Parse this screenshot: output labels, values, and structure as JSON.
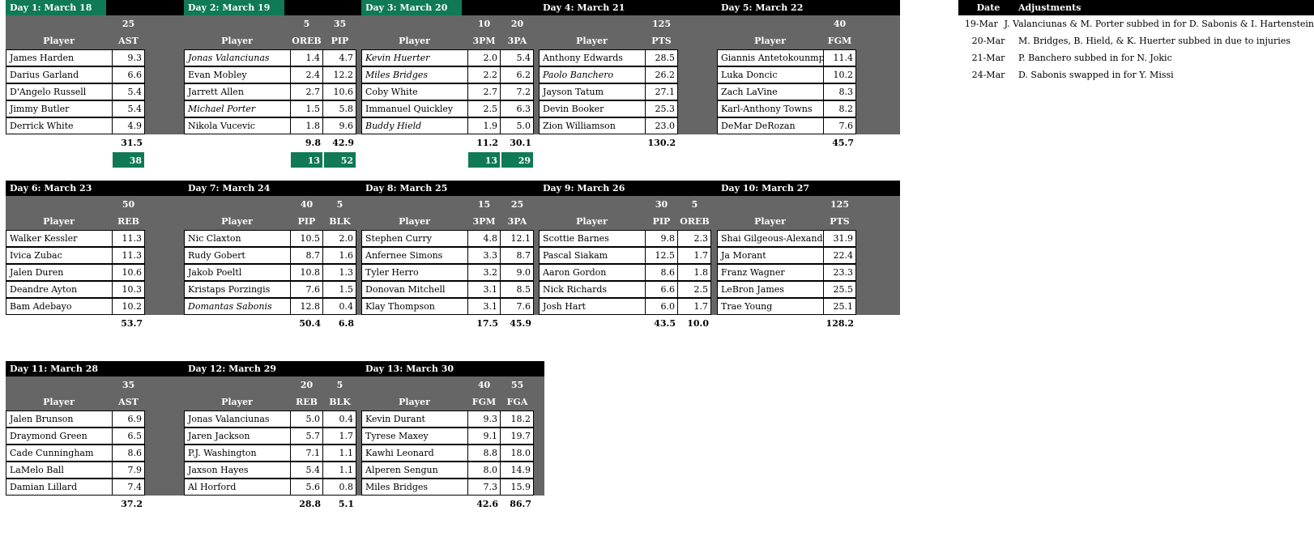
{
  "days": [
    {
      "title": "Day 1: March 18",
      "highlight": true,
      "targets": [
        "25"
      ],
      "stats": [
        "AST"
      ],
      "player_header": "Player",
      "rows": [
        {
          "name": "James Harden",
          "vals": [
            "9.3"
          ]
        },
        {
          "name": "Darius Garland",
          "vals": [
            "6.6"
          ]
        },
        {
          "name": "D'Angelo Russell",
          "vals": [
            "5.4"
          ]
        },
        {
          "name": "Jimmy Butler",
          "vals": [
            "5.4"
          ]
        },
        {
          "name": "Derrick White",
          "vals": [
            "4.9"
          ]
        }
      ],
      "totals": [
        "31.5"
      ],
      "results": [
        "38"
      ]
    },
    {
      "title": "Day 2: March 19",
      "highlight": true,
      "targets": [
        "5",
        "35"
      ],
      "stats": [
        "OREB",
        "PIP"
      ],
      "player_header": "Player",
      "rows": [
        {
          "name": "Jonas Valanciunas",
          "italic": true,
          "vals": [
            "1.4",
            "4.7"
          ]
        },
        {
          "name": "Evan Mobley",
          "vals": [
            "2.4",
            "12.2"
          ]
        },
        {
          "name": "Jarrett Allen",
          "vals": [
            "2.7",
            "10.6"
          ]
        },
        {
          "name": "Michael Porter",
          "italic": true,
          "vals": [
            "1.5",
            "5.8"
          ]
        },
        {
          "name": "Nikola Vucevic",
          "vals": [
            "1.8",
            "9.6"
          ]
        }
      ],
      "totals": [
        "9.8",
        "42.9"
      ],
      "results": [
        "13",
        "52"
      ]
    },
    {
      "title": "Day 3: March 20",
      "highlight": true,
      "targets": [
        "10",
        "20"
      ],
      "stats": [
        "3PM",
        "3PA"
      ],
      "player_header": "Player",
      "rows": [
        {
          "name": "Kevin Huerter",
          "italic": true,
          "vals": [
            "2.0",
            "5.4"
          ]
        },
        {
          "name": "Miles Bridges",
          "italic": true,
          "vals": [
            "2.2",
            "6.2"
          ]
        },
        {
          "name": "Coby White",
          "vals": [
            "2.7",
            "7.2"
          ]
        },
        {
          "name": "Immanuel Quickley",
          "vals": [
            "2.5",
            "6.3"
          ]
        },
        {
          "name": "Buddy Hield",
          "italic": true,
          "vals": [
            "1.9",
            "5.0"
          ]
        }
      ],
      "totals": [
        "11.2",
        "30.1"
      ],
      "results": [
        "13",
        "29"
      ]
    },
    {
      "title": "Day 4: March 21",
      "highlight": false,
      "targets": [
        "125"
      ],
      "stats": [
        "PTS"
      ],
      "player_header": "Player",
      "rows": [
        {
          "name": "Anthony Edwards",
          "vals": [
            "28.5"
          ]
        },
        {
          "name": "Paolo Banchero",
          "italic": true,
          "vals": [
            "26.2"
          ]
        },
        {
          "name": "Jayson Tatum",
          "vals": [
            "27.1"
          ]
        },
        {
          "name": "Devin Booker",
          "vals": [
            "25.3"
          ]
        },
        {
          "name": "Zion Williamson",
          "vals": [
            "23.0"
          ]
        }
      ],
      "totals": [
        "130.2"
      ],
      "results": []
    },
    {
      "title": "Day 5: March 22",
      "highlight": false,
      "targets": [
        "40"
      ],
      "stats": [
        "FGM"
      ],
      "player_header": "Player",
      "rows": [
        {
          "name": "Giannis Antetokounmpo",
          "vals": [
            "11.4"
          ]
        },
        {
          "name": "Luka Doncic",
          "vals": [
            "10.2"
          ]
        },
        {
          "name": "Zach LaVine",
          "vals": [
            "8.3"
          ]
        },
        {
          "name": "Karl-Anthony Towns",
          "vals": [
            "8.2"
          ]
        },
        {
          "name": "DeMar DeRozan",
          "vals": [
            "7.6"
          ]
        }
      ],
      "totals": [
        "45.7"
      ],
      "results": []
    },
    {
      "title": "Day 6: March 23",
      "highlight": false,
      "targets": [
        "50"
      ],
      "stats": [
        "REB"
      ],
      "player_header": "Player",
      "rows": [
        {
          "name": "Walker Kessler",
          "vals": [
            "11.3"
          ]
        },
        {
          "name": "Ivica Zubac",
          "vals": [
            "11.3"
          ]
        },
        {
          "name": "Jalen Duren",
          "vals": [
            "10.6"
          ]
        },
        {
          "name": "Deandre Ayton",
          "vals": [
            "10.3"
          ]
        },
        {
          "name": "Bam Adebayo",
          "vals": [
            "10.2"
          ]
        }
      ],
      "totals": [
        "53.7"
      ],
      "results": []
    },
    {
      "title": "Day 7: March 24",
      "highlight": false,
      "targets": [
        "40",
        "5"
      ],
      "stats": [
        "PIP",
        "BLK"
      ],
      "player_header": "Player",
      "rows": [
        {
          "name": "Nic Claxton",
          "vals": [
            "10.5",
            "2.0"
          ]
        },
        {
          "name": "Rudy Gobert",
          "vals": [
            "8.7",
            "1.6"
          ]
        },
        {
          "name": "Jakob Poeltl",
          "vals": [
            "10.8",
            "1.3"
          ]
        },
        {
          "name": "Kristaps Porzingis",
          "vals": [
            "7.6",
            "1.5"
          ]
        },
        {
          "name": "Domantas Sabonis",
          "italic": true,
          "vals": [
            "12.8",
            "0.4"
          ]
        }
      ],
      "totals": [
        "50.4",
        "6.8"
      ],
      "results": []
    },
    {
      "title": "Day 8: March 25",
      "highlight": false,
      "targets": [
        "15",
        "25"
      ],
      "stats": [
        "3PM",
        "3PA"
      ],
      "player_header": "Player",
      "rows": [
        {
          "name": "Stephen Curry",
          "vals": [
            "4.8",
            "12.1"
          ]
        },
        {
          "name": "Anfernee Simons",
          "vals": [
            "3.3",
            "8.7"
          ]
        },
        {
          "name": "Tyler Herro",
          "vals": [
            "3.2",
            "9.0"
          ]
        },
        {
          "name": "Donovan Mitchell",
          "vals": [
            "3.1",
            "8.5"
          ]
        },
        {
          "name": "Klay Thompson",
          "vals": [
            "3.1",
            "7.6"
          ]
        }
      ],
      "totals": [
        "17.5",
        "45.9"
      ],
      "results": []
    },
    {
      "title": "Day 9: March 26",
      "highlight": false,
      "targets": [
        "30",
        "5"
      ],
      "stats": [
        "PIP",
        "OREB"
      ],
      "player_header": "Player",
      "rows": [
        {
          "name": "Scottie Barnes",
          "vals": [
            "9.8",
            "2.3"
          ]
        },
        {
          "name": "Pascal Siakam",
          "vals": [
            "12.5",
            "1.7"
          ]
        },
        {
          "name": "Aaron Gordon",
          "vals": [
            "8.6",
            "1.8"
          ]
        },
        {
          "name": "Nick Richards",
          "vals": [
            "6.6",
            "2.5"
          ]
        },
        {
          "name": "Josh Hart",
          "vals": [
            "6.0",
            "1.7"
          ]
        }
      ],
      "totals": [
        "43.5",
        "10.0"
      ],
      "results": []
    },
    {
      "title": "Day 10: March 27",
      "highlight": false,
      "targets": [
        "125"
      ],
      "stats": [
        "PTS"
      ],
      "player_header": "Player",
      "rows": [
        {
          "name": "Shai Gilgeous-Alexander",
          "vals": [
            "31.9"
          ]
        },
        {
          "name": "Ja Morant",
          "vals": [
            "22.4"
          ]
        },
        {
          "name": "Franz Wagner",
          "vals": [
            "23.3"
          ]
        },
        {
          "name": "LeBron James",
          "vals": [
            "25.5"
          ]
        },
        {
          "name": "Trae Young",
          "vals": [
            "25.1"
          ]
        }
      ],
      "totals": [
        "128.2"
      ],
      "results": []
    },
    {
      "title": "Day 11: March 28",
      "highlight": false,
      "targets": [
        "35"
      ],
      "stats": [
        "AST"
      ],
      "player_header": "Player",
      "rows": [
        {
          "name": "Jalen Brunson",
          "vals": [
            "6.9"
          ]
        },
        {
          "name": "Draymond Green",
          "vals": [
            "6.5"
          ]
        },
        {
          "name": "Cade Cunningham",
          "vals": [
            "8.6"
          ]
        },
        {
          "name": "LaMelo Ball",
          "vals": [
            "7.9"
          ]
        },
        {
          "name": "Damian Lillard",
          "vals": [
            "7.4"
          ]
        }
      ],
      "totals": [
        "37.2"
      ],
      "results": []
    },
    {
      "title": "Day 12: March 29",
      "highlight": false,
      "targets": [
        "20",
        "5"
      ],
      "stats": [
        "REB",
        "BLK"
      ],
      "player_header": "Player",
      "rows": [
        {
          "name": "Jonas Valanciunas",
          "vals": [
            "5.0",
            "0.4"
          ]
        },
        {
          "name": "Jaren Jackson",
          "vals": [
            "5.7",
            "1.7"
          ]
        },
        {
          "name": "P.J. Washington",
          "vals": [
            "7.1",
            "1.1"
          ]
        },
        {
          "name": "Jaxson Hayes",
          "vals": [
            "5.4",
            "1.1"
          ]
        },
        {
          "name": "Al Horford",
          "vals": [
            "5.6",
            "0.8"
          ]
        }
      ],
      "totals": [
        "28.8",
        "5.1"
      ],
      "results": []
    },
    {
      "title": "Day 13: March 30",
      "highlight": false,
      "targets": [
        "40",
        "55"
      ],
      "stats": [
        "FGM",
        "FGA"
      ],
      "player_header": "Player",
      "rows": [
        {
          "name": "Kevin Durant",
          "vals": [
            "9.3",
            "18.2"
          ]
        },
        {
          "name": "Tyrese Maxey",
          "vals": [
            "9.1",
            "19.7"
          ]
        },
        {
          "name": "Kawhi Leonard",
          "vals": [
            "8.8",
            "18.0"
          ]
        },
        {
          "name": "Alperen Sengun",
          "vals": [
            "8.0",
            "14.9"
          ]
        },
        {
          "name": "Miles Bridges",
          "vals": [
            "7.3",
            "15.9"
          ]
        }
      ],
      "totals": [
        "42.6",
        "86.7"
      ],
      "results": []
    }
  ],
  "adjustments": {
    "header_date": "Date",
    "header_text": "Adjustments",
    "rows": [
      {
        "date": "19-Mar",
        "text": "J. Valanciunas & M. Porter subbed in for D. Sabonis & I. Hartenstein"
      },
      {
        "date": "20-Mar",
        "text": "M. Bridges, B. Hield, & K. Huerter subbed in due to injuries"
      },
      {
        "date": "21-Mar",
        "text": "P. Banchero subbed in for N. Jokic"
      },
      {
        "date": "24-Mar",
        "text": "D. Sabonis swapped in for Y. Missi"
      }
    ]
  },
  "colors": {
    "header_bg": "#000000",
    "highlight_green": "#0f7a55",
    "panel_grey": "#666666"
  }
}
